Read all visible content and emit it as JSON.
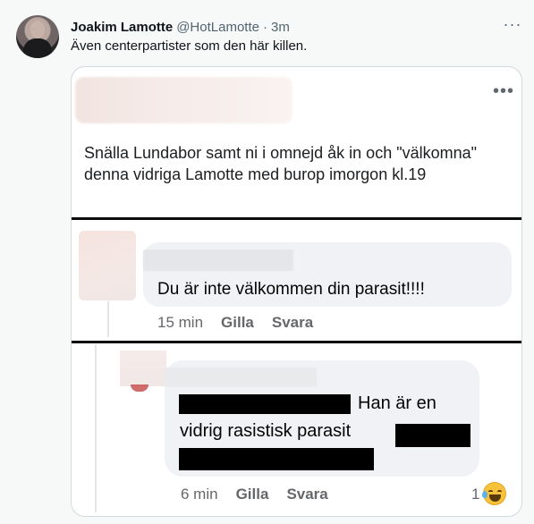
{
  "tweet": {
    "author_name": "Joakim Lamotte",
    "author_handle": "@HotLamotte",
    "separator": "·",
    "time": "3m",
    "text": "Även centerpartister som den här killen.",
    "more_icon": "more-horizontal-icon"
  },
  "embedded_screenshot": {
    "post": {
      "text": "Snälla Lundabor samt ni i omnejd åk in och \"välkomna\" denna vidriga Lamotte med burop imorgon kl.19",
      "more_icon": "more-horizontal-icon"
    },
    "comment": {
      "text": "Du är inte välkommen din parasit!!!!",
      "time": "15 min",
      "like_label": "Gilla",
      "reply_label": "Svara"
    },
    "reply": {
      "text_line1": "Han är en",
      "text_line2": "vidrig rasistisk parasit",
      "time": "6 min",
      "like_label": "Gilla",
      "reply_label": "Svara",
      "reaction_count": "1",
      "reaction_icon": "laughing-emoji-icon"
    }
  },
  "colors": {
    "name": "#0f1419",
    "secondary": "#536471",
    "bubble": "#f0f2f5",
    "fb_meta": "#65676b"
  }
}
